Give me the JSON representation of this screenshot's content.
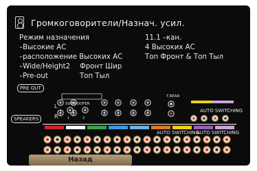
{
  "header": {
    "title": "Громкоговорители/Назнач. усил.",
    "icon": "speaker-icon"
  },
  "settings": [
    {
      "label": "Режим назначения",
      "value": "11.1 –кан."
    },
    {
      "label": "–Высокие АС",
      "value": "4 Высоких АС"
    },
    {
      "label": "–расположение Высоких АС",
      "value": "Топ Фронт & Топ Тыл"
    },
    {
      "label": "–Wide/Height2",
      "value": "Фронт Шир"
    },
    {
      "label": "–Pre-out",
      "value": "Топ Тыл"
    }
  ],
  "diagram": {
    "preout_label": "PRE OUT",
    "speakers_label": "SPEAKERS",
    "subwoofer_label": "SUBWOOFER",
    "subwoofer_nums": [
      "1",
      "2"
    ],
    "trear_label": "T.REAR",
    "auto_switching_label": "AUTO SWITCHING",
    "left_right": [
      "L",
      "R"
    ],
    "channel_colors": [
      "#d2232a",
      "#ffffff",
      "#2fa84f",
      "#3b9be0",
      "#69b6ea",
      "#e07b25",
      "#f0d214",
      "#9b5fc0",
      "#c9a6dc"
    ]
  },
  "footer": {
    "back_label": "Назад"
  }
}
